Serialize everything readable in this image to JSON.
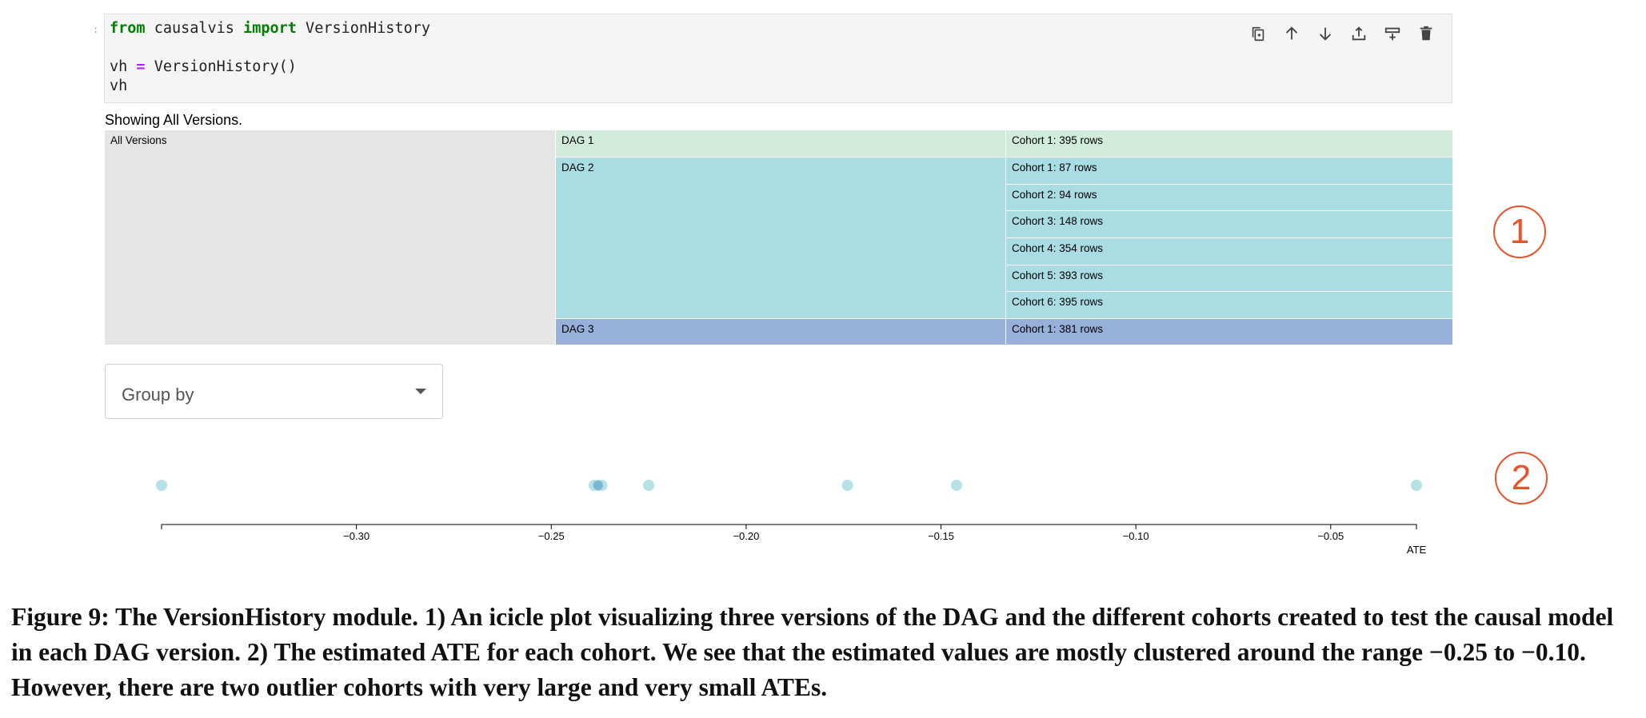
{
  "code_cell": {
    "prompt": ":",
    "line1": {
      "kw1": "from",
      "mod": " causalvis ",
      "kw2": "import",
      "rest": " VersionHistory"
    },
    "line3": {
      "a": "vh ",
      "op": "=",
      "b": " VersionHistory()"
    },
    "line4": "vh",
    "toolbar": [
      "copy-icon",
      "arrow-up-icon",
      "arrow-down-icon",
      "insert-above-icon",
      "insert-below-icon",
      "trash-icon"
    ]
  },
  "output": {
    "showing_text": "Showing All Versions.",
    "icicle": {
      "root": "All Versions",
      "dags": [
        {
          "label": "DAG 1",
          "color": "#d2ecdc",
          "cohorts": [
            "Cohort 1: 395 rows"
          ]
        },
        {
          "label": "DAG 2",
          "color": "#a9dce3",
          "cohorts": [
            "Cohort 1: 87 rows",
            "Cohort 2: 94 rows",
            "Cohort 3: 148 rows",
            "Cohort 4: 354 rows",
            "Cohort 5: 393 rows",
            "Cohort 6: 395 rows"
          ]
        },
        {
          "label": "DAG 3",
          "color": "#97b0da",
          "cohorts": [
            "Cohort 1: 381 rows"
          ]
        }
      ]
    },
    "group_by": {
      "label": "Group by"
    }
  },
  "chart_data": {
    "type": "scatter",
    "xlabel": "ATE",
    "xlim": [
      -0.35,
      -0.028
    ],
    "ticks": [
      -0.3,
      -0.25,
      -0.2,
      -0.15,
      -0.1,
      -0.05
    ],
    "tick_labels": [
      "−0.30",
      "−0.25",
      "−0.20",
      "−0.15",
      "−0.10",
      "−0.05"
    ],
    "values": [
      -0.35,
      -0.239,
      -0.238,
      -0.237,
      -0.225,
      -0.174,
      -0.146,
      -0.028
    ],
    "point_color": "#a9dce3",
    "overlap_color": "#5b9fc0"
  },
  "annotations": {
    "badge1": "1",
    "badge2": "2"
  },
  "caption": "Figure 9: The VersionHistory module. 1) An icicle plot visualizing three versions of the DAG and the different cohorts created to test the causal model in each DAG version. 2) The estimated ATE for each cohort. We see that the estimated values are mostly clustered around the range −0.25 to −0.10. However, there are two outlier cohorts with very large and very small ATEs."
}
